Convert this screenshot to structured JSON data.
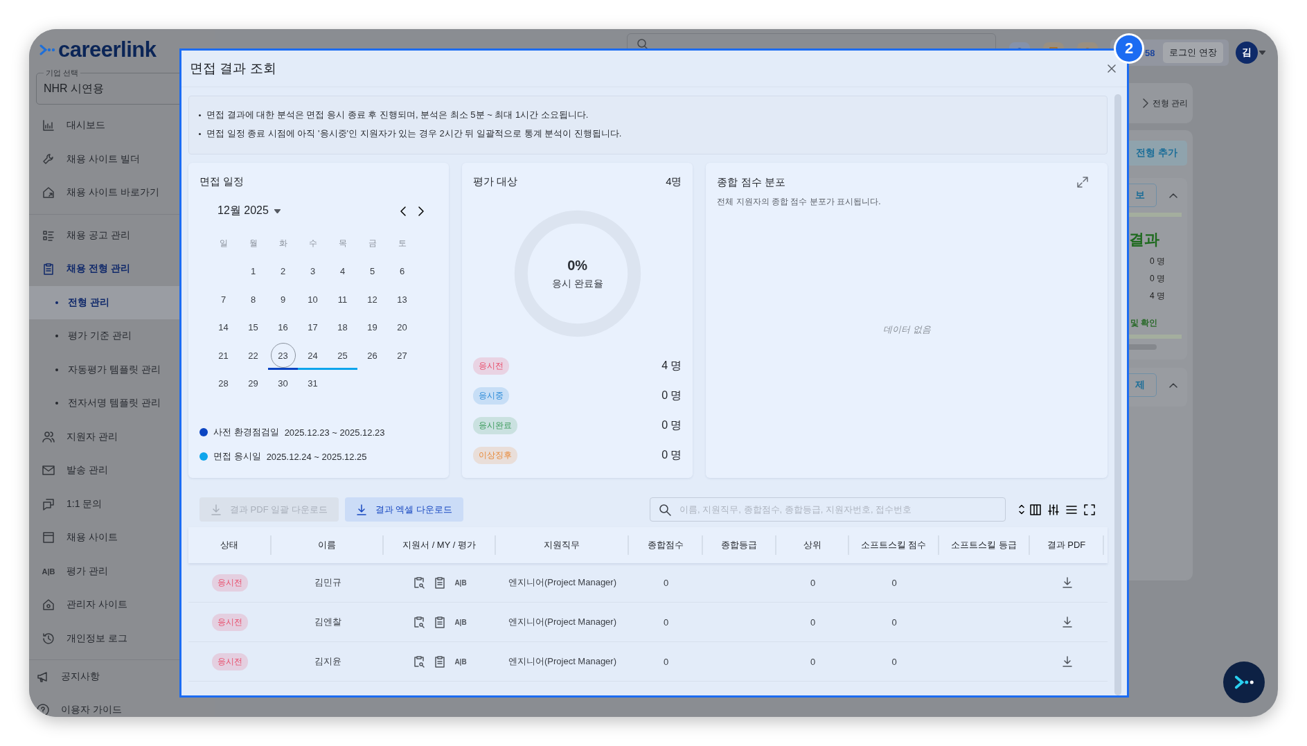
{
  "sidebar": {
    "logo": "careerlink",
    "company_select": {
      "label": "기업 선택",
      "value": "NHR 시연용"
    },
    "sections": [
      {
        "items": [
          {
            "label": "대시보드",
            "selected": false,
            "expanded": false
          },
          {
            "label": "채용 사이트 빌더",
            "selected": false,
            "expanded": false
          },
          {
            "label": "채용 사이트 바로가기",
            "selected": false,
            "expanded": false
          }
        ]
      },
      {
        "items": [
          {
            "label": "채용 공고 관리",
            "selected": false,
            "expanded": false
          },
          {
            "label": "채용 전형 관리",
            "selected": false,
            "expanded": true,
            "children": [
              {
                "label": "전형 관리",
                "selected": true
              },
              {
                "label": "평가 기준 관리",
                "selected": false
              },
              {
                "label": "자동평가 템플릿 관리",
                "selected": false
              },
              {
                "label": "전자서명 템플릿 관리",
                "selected": false
              }
            ]
          },
          {
            "label": "지원자 관리",
            "selected": false,
            "expanded": false
          },
          {
            "label": "발송 관리",
            "selected": false,
            "expanded": false
          },
          {
            "label": "1:1 문의",
            "selected": false,
            "expanded": false
          },
          {
            "label": "채용 사이트",
            "selected": false,
            "expanded": false
          },
          {
            "label": "평가 관리",
            "icon_text": "A|B",
            "selected": false,
            "expanded": false
          },
          {
            "label": "관리자 사이트",
            "selected": false,
            "expanded": false
          },
          {
            "label": "개인정보 로그",
            "selected": false,
            "expanded": false
          }
        ]
      },
      {
        "items": [
          {
            "label": "공지사항",
            "selected": false,
            "expanded": false
          },
          {
            "label": "이용자 가이드",
            "selected": false,
            "expanded": false
          }
        ]
      }
    ]
  },
  "top_bar": {
    "timer": "58",
    "extend_button": "로그인 연장",
    "avatar": "김"
  },
  "background_page": {
    "breadcrumb": "전형 관리",
    "add_button": "전형 추가",
    "stage_button": "보",
    "stage_title": "결과",
    "counts": [
      "0 명",
      "0 명",
      "4 명"
    ],
    "stage_link": "및 확인",
    "stage2_button": "제"
  },
  "modal": {
    "title": "면접 결과 조회",
    "badge": "2",
    "notices": [
      "면접 결과에 대한 분석은 면접 응시 종료 후 진행되며, 분석은 최소 5분 ~ 최대 1시간 소요됩니다.",
      "면접 일정 종료 시점에 아직 '응시중'인 지원자가 있는 경우 2시간 뒤 일괄적으로 통계 분석이 진행됩니다."
    ],
    "schedule": {
      "title": "면접 일정",
      "month": "12월 2025",
      "weekdays": [
        "일",
        "월",
        "화",
        "수",
        "목",
        "금",
        "토"
      ],
      "weeks": [
        {
          "days": [
            {
              "kind": "blank"
            },
            {
              "kind": "day",
              "day": "1",
              "today": false
            },
            {
              "day": "2",
              "today": false
            },
            {
              "day": "3",
              "today": false
            },
            {
              "day": "4",
              "today": false
            },
            {
              "day": "5",
              "today": false
            },
            {
              "day": "6",
              "today": false
            }
          ]
        },
        {
          "days": [
            {
              "day": "7",
              "today": false
            },
            {
              "day": "8",
              "today": false
            },
            {
              "day": "9",
              "today": false
            },
            {
              "day": "10",
              "today": false
            },
            {
              "day": "11",
              "today": false
            },
            {
              "day": "12",
              "today": false
            },
            {
              "day": "13",
              "today": false
            }
          ]
        },
        {
          "days": [
            {
              "day": "14",
              "today": false
            },
            {
              "day": "15",
              "today": false
            },
            {
              "day": "16",
              "today": false
            },
            {
              "day": "17",
              "today": false
            },
            {
              "day": "18",
              "today": false
            },
            {
              "day": "19",
              "today": false
            },
            {
              "day": "20",
              "today": false
            }
          ]
        },
        {
          "days": [
            {
              "day": "21",
              "today": false
            },
            {
              "day": "22",
              "today": false
            },
            {
              "day": "23",
              "today": true,
              "color": "#0b45c2"
            },
            {
              "day": "24",
              "today": false,
              "color": "#0ea5ec"
            },
            {
              "day": "25",
              "today": false,
              "color": "#0ea5ec"
            },
            {
              "day": "26",
              "today": false
            },
            {
              "day": "27",
              "today": false
            }
          ]
        },
        {
          "days": [
            {
              "day": "28",
              "today": false
            },
            {
              "day": "29",
              "today": false
            },
            {
              "day": "30",
              "today": false
            },
            {
              "day": "31",
              "today": false
            }
          ]
        }
      ],
      "legend": [
        {
          "label": "사전 환경점검일",
          "range": "2025.12.23 ~ 2025.12.23",
          "color": "#0b45c2"
        },
        {
          "label": "면접 응시일",
          "range": "2025.12.24 ~ 2025.12.25",
          "color": "#0ea5ec"
        }
      ]
    },
    "target": {
      "title": "평가 대상",
      "count": "4명",
      "donut": {
        "value": "0%",
        "label": "응시 완료율"
      },
      "stats": [
        {
          "label": "응시전",
          "color": "#e8506e",
          "count": "4 명"
        },
        {
          "label": "응시중",
          "color": "#2d8bd8",
          "count": "0 명"
        },
        {
          "label": "응시완료",
          "color": "#3d9b5c",
          "count": "0 명"
        },
        {
          "label": "이상징후",
          "color": "#e88a3a",
          "count": "0 명"
        }
      ]
    },
    "distribution": {
      "title": "종합 점수 분포",
      "subtitle": "전체 지원자의 종합 점수 분포가 표시됩니다.",
      "empty": "데이터 없음"
    },
    "toolbar": {
      "buttons": [
        {
          "label": "결과 PDF 일괄 다운로드",
          "disabled": true
        },
        {
          "label": "결과 엑셀 다운로드",
          "disabled": false
        }
      ],
      "search_placeholder": "이름, 지원직무, 종합점수, 종합등급, 지원자번호, 접수번호"
    },
    "table": {
      "columns": [
        "상태",
        "이름",
        "지원서 / MY / 평가",
        "지원직무",
        "종합점수",
        "종합등급",
        "상위",
        "소프트스킬 점수",
        "소프트스킬 등급",
        "결과 PDF"
      ],
      "rows": [
        {
          "status": {
            "label": "응시전",
            "color": "#e8506e"
          },
          "name": "김민규",
          "eval_icon": "A|B",
          "job": "엔지니어(Project Manager)",
          "total": "0",
          "rank": "0",
          "soft_score": "0"
        },
        {
          "status": {
            "label": "응시전",
            "color": "#e8506e"
          },
          "name": "김엔찰",
          "eval_icon": "A|B",
          "job": "엔지니어(Project Manager)",
          "total": "0",
          "rank": "0",
          "soft_score": "0"
        },
        {
          "status": {
            "label": "응시전",
            "color": "#e8506e"
          },
          "name": "김지윤",
          "eval_icon": "A|B",
          "job": "엔지니어(Project Manager)",
          "total": "0",
          "rank": "0",
          "soft_score": "0"
        }
      ]
    }
  }
}
